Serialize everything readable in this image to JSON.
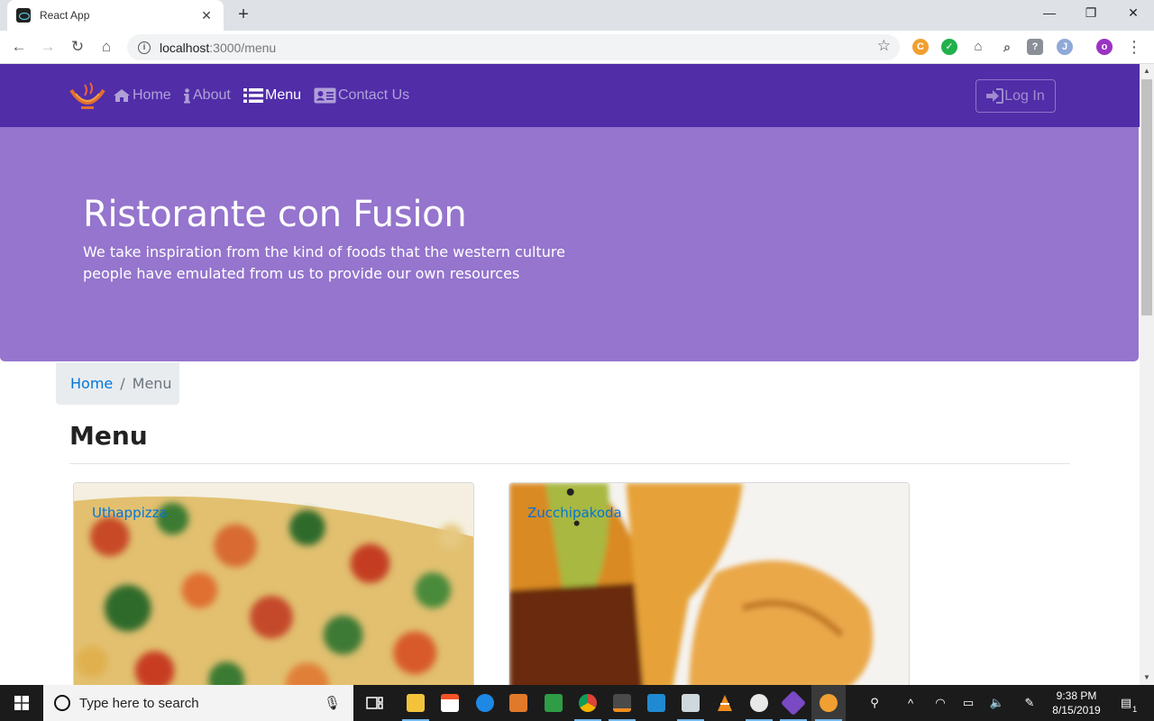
{
  "browser": {
    "tab_title": "React App",
    "url_host": "localhost",
    "url_path": ":3000/menu",
    "profile_initial": "o"
  },
  "navbar": {
    "items": [
      {
        "label": "Home",
        "icon": "home-icon"
      },
      {
        "label": "About",
        "icon": "info-icon"
      },
      {
        "label": "Menu",
        "icon": "list-icon",
        "active": true
      },
      {
        "label": "Contact Us",
        "icon": "address-card-icon"
      }
    ],
    "login_label": "Log In",
    "background_color": "#512da8"
  },
  "jumbotron": {
    "title": "Ristorante con Fusion",
    "text": "We take inspiration from the kind of foods that the western culture people have emulated from us to provide our own resources",
    "background_color": "#9575cd"
  },
  "breadcrumb": {
    "home": "Home",
    "separator": "/",
    "current": "Menu"
  },
  "page": {
    "heading": "Menu"
  },
  "dishes": [
    {
      "name": "Uthappizza"
    },
    {
      "name": "Zucchipakoda"
    }
  ],
  "taskbar": {
    "search_placeholder": "Type here to search",
    "time": "9:38 PM",
    "date": "8/15/2019",
    "notification_count": "1"
  }
}
